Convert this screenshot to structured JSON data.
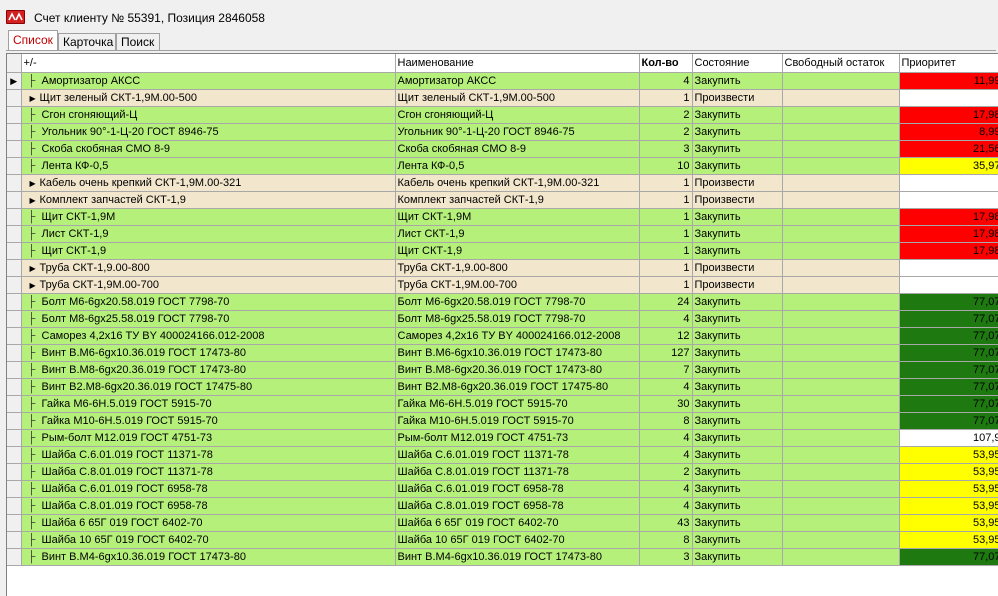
{
  "window": {
    "title": "Счет клиенту № 55391, Позиция 2846058"
  },
  "tabs": [
    {
      "label": "Список",
      "active": true
    },
    {
      "label": "Карточка",
      "active": false
    },
    {
      "label": "Поиск",
      "active": false
    }
  ],
  "grid": {
    "columns": {
      "tree": "+/-",
      "name": "Наименование",
      "qty": "Кол-во",
      "state": "Состояние",
      "free": "Свободный остаток",
      "priority": "Приоритет"
    },
    "colors": {
      "buy_row": "#b5f07a",
      "make_row": "#f2e6cc",
      "priority_red": "#ff0000",
      "priority_yellow": "#ffff00",
      "priority_green": "#1e7a10",
      "priority_white": "#ffffff"
    },
    "rows": [
      {
        "tree": "Амортизатор АКСС",
        "name": "Амортизатор АКСС",
        "qty": "4",
        "state": "Закупить",
        "free": "",
        "priority": "11,99",
        "pcolor": "red",
        "kind": "buy",
        "expander": false,
        "current": true
      },
      {
        "tree": "Щит зеленый СКТ-1,9М.00-500",
        "name": "Щит зеленый СКТ-1,9М.00-500",
        "qty": "1",
        "state": "Произвести",
        "free": "",
        "priority": "",
        "pcolor": "white",
        "kind": "make",
        "expander": true
      },
      {
        "tree": "Сгон сгоняющий-Ц",
        "name": "Сгон сгоняющий-Ц",
        "qty": "2",
        "state": "Закупить",
        "free": "",
        "priority": "17,98",
        "pcolor": "red",
        "kind": "buy",
        "expander": false
      },
      {
        "tree": "Угольник 90°-1-Ц-20 ГОСТ 8946-75",
        "name": "Угольник 90°-1-Ц-20 ГОСТ 8946-75",
        "qty": "2",
        "state": "Закупить",
        "free": "",
        "priority": "8,99",
        "pcolor": "red",
        "kind": "buy",
        "expander": false
      },
      {
        "tree": "Скоба скобяная СМО 8-9",
        "name": "Скоба скобяная СМО 8-9",
        "qty": "3",
        "state": "Закупить",
        "free": "",
        "priority": "21,56",
        "pcolor": "red",
        "kind": "buy",
        "expander": false
      },
      {
        "tree": "Лента КФ-0,5",
        "name": "Лента КФ-0,5",
        "qty": "10",
        "state": "Закупить",
        "free": "",
        "priority": "35,97",
        "pcolor": "yellow",
        "kind": "buy",
        "expander": false
      },
      {
        "tree": "Кабель очень крепкий СКТ-1,9М.00-321",
        "name": "Кабель очень крепкий СКТ-1,9М.00-321",
        "qty": "1",
        "state": "Произвести",
        "free": "",
        "priority": "",
        "pcolor": "white",
        "kind": "make",
        "expander": true
      },
      {
        "tree": "Комплект запчастей СКТ-1,9",
        "name": "Комплект запчастей СКТ-1,9",
        "qty": "1",
        "state": "Произвести",
        "free": "",
        "priority": "",
        "pcolor": "white",
        "kind": "make",
        "expander": true
      },
      {
        "tree": "Щит  СКТ-1,9М",
        "name": "Щит  СКТ-1,9М",
        "qty": "1",
        "state": "Закупить",
        "free": "",
        "priority": "17,98",
        "pcolor": "red",
        "kind": "buy",
        "expander": false
      },
      {
        "tree": "Лист СКТ-1,9",
        "name": "Лист СКТ-1,9",
        "qty": "1",
        "state": "Закупить",
        "free": "",
        "priority": "17,98",
        "pcolor": "red",
        "kind": "buy",
        "expander": false
      },
      {
        "tree": "Щит СКТ-1,9",
        "name": "Щит СКТ-1,9",
        "qty": "1",
        "state": "Закупить",
        "free": "",
        "priority": "17,98",
        "pcolor": "red",
        "kind": "buy",
        "expander": false
      },
      {
        "tree": "Труба СКТ-1,9.00-800",
        "name": "Труба СКТ-1,9.00-800",
        "qty": "1",
        "state": "Произвести",
        "free": "",
        "priority": "",
        "pcolor": "white",
        "kind": "make",
        "expander": true
      },
      {
        "tree": "Труба  СКТ-1,9М.00-700",
        "name": "Труба  СКТ-1,9М.00-700",
        "qty": "1",
        "state": "Произвести",
        "free": "",
        "priority": "",
        "pcolor": "white",
        "kind": "make",
        "expander": true
      },
      {
        "tree": "Болт М6-6gх20.58.019 ГОСТ 7798-70",
        "name": "Болт М6-6gх20.58.019 ГОСТ 7798-70",
        "qty": "24",
        "state": "Закупить",
        "free": "",
        "priority": "77,07",
        "pcolor": "green",
        "kind": "buy",
        "expander": false
      },
      {
        "tree": "Болт М8-6gх25.58.019 ГОСТ 7798-70",
        "name": "Болт М8-6gх25.58.019 ГОСТ 7798-70",
        "qty": "4",
        "state": "Закупить",
        "free": "",
        "priority": "77,07",
        "pcolor": "green",
        "kind": "buy",
        "expander": false
      },
      {
        "tree": "Саморез 4,2х16 ТУ BY 400024166.012-2008",
        "name": "Саморез 4,2х16 ТУ BY 400024166.012-2008",
        "qty": "12",
        "state": "Закупить",
        "free": "",
        "priority": "77,07",
        "pcolor": "green",
        "kind": "buy",
        "expander": false
      },
      {
        "tree": "Винт В.М6-6gх10.36.019 ГОСТ 17473-80",
        "name": "Винт В.М6-6gх10.36.019 ГОСТ 17473-80",
        "qty": "127",
        "state": "Закупить",
        "free": "",
        "priority": "77,07",
        "pcolor": "green",
        "kind": "buy",
        "expander": false
      },
      {
        "tree": "Винт В.М8-6gх20.36.019 ГОСТ 17473-80",
        "name": "Винт В.М8-6gх20.36.019 ГОСТ 17473-80",
        "qty": "7",
        "state": "Закупить",
        "free": "",
        "priority": "77,07",
        "pcolor": "green",
        "kind": "buy",
        "expander": false
      },
      {
        "tree": "Винт В2.М8-6gх20.36.019 ГОСТ 17475-80",
        "name": "Винт В2.М8-6gх20.36.019 ГОСТ 17475-80",
        "qty": "4",
        "state": "Закупить",
        "free": "",
        "priority": "77,07",
        "pcolor": "green",
        "kind": "buy",
        "expander": false
      },
      {
        "tree": "Гайка М6-6Н.5.019 ГОСТ 5915-70",
        "name": "Гайка М6-6Н.5.019 ГОСТ 5915-70",
        "qty": "30",
        "state": "Закупить",
        "free": "",
        "priority": "77,07",
        "pcolor": "green",
        "kind": "buy",
        "expander": false
      },
      {
        "tree": "Гайка М10-6Н.5.019 ГОСТ 5915-70",
        "name": "Гайка М10-6Н.5.019 ГОСТ 5915-70",
        "qty": "8",
        "state": "Закупить",
        "free": "",
        "priority": "77,07",
        "pcolor": "green",
        "kind": "buy",
        "expander": false
      },
      {
        "tree": "Рым-болт М12.019 ГОСТ 4751-73",
        "name": "Рым-болт М12.019 ГОСТ 4751-73",
        "qty": "4",
        "state": "Закупить",
        "free": "",
        "priority": "107,9",
        "pcolor": "white",
        "kind": "buy",
        "expander": false
      },
      {
        "tree": "Шайба С.6.01.019 ГОСТ 11371-78",
        "name": "Шайба С.6.01.019 ГОСТ 11371-78",
        "qty": "4",
        "state": "Закупить",
        "free": "",
        "priority": "53,95",
        "pcolor": "yellow",
        "kind": "buy",
        "expander": false
      },
      {
        "tree": "Шайба С.8.01.019 ГОСТ 11371-78",
        "name": "Шайба С.8.01.019 ГОСТ 11371-78",
        "qty": "2",
        "state": "Закупить",
        "free": "",
        "priority": "53,95",
        "pcolor": "yellow",
        "kind": "buy",
        "expander": false
      },
      {
        "tree": "Шайба С.6.01.019 ГОСТ 6958-78",
        "name": "Шайба С.6.01.019 ГОСТ 6958-78",
        "qty": "4",
        "state": "Закупить",
        "free": "",
        "priority": "53,95",
        "pcolor": "yellow",
        "kind": "buy",
        "expander": false
      },
      {
        "tree": "Шайба С.8.01.019 ГОСТ 6958-78",
        "name": "Шайба С.8.01.019 ГОСТ 6958-78",
        "qty": "4",
        "state": "Закупить",
        "free": "",
        "priority": "53,95",
        "pcolor": "yellow",
        "kind": "buy",
        "expander": false
      },
      {
        "tree": "Шайба 6 65Г 019 ГОСТ 6402-70",
        "name": "Шайба 6 65Г 019 ГОСТ 6402-70",
        "qty": "43",
        "state": "Закупить",
        "free": "",
        "priority": "53,95",
        "pcolor": "yellow",
        "kind": "buy",
        "expander": false
      },
      {
        "tree": "Шайба 10 65Г 019 ГОСТ 6402-70",
        "name": "Шайба 10 65Г 019 ГОСТ 6402-70",
        "qty": "8",
        "state": "Закупить",
        "free": "",
        "priority": "53,95",
        "pcolor": "yellow",
        "kind": "buy",
        "expander": false
      },
      {
        "tree": "Винт В.М4-6gх10.36.019 ГОСТ 17473-80",
        "name": "Винт В.М4-6gх10.36.019 ГОСТ 17473-80",
        "qty": "3",
        "state": "Закупить",
        "free": "",
        "priority": "77,07",
        "pcolor": "green",
        "kind": "buy",
        "expander": false
      }
    ]
  }
}
